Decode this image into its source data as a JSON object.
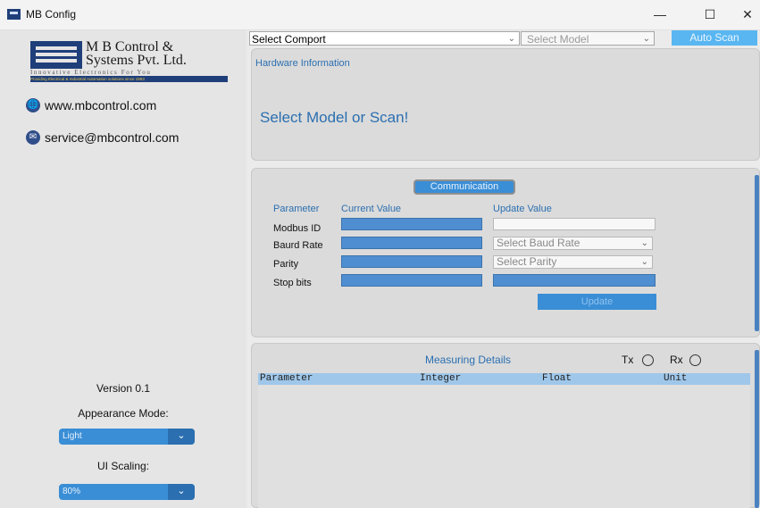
{
  "window": {
    "title": "MB Config",
    "controls": {
      "minimize": "—",
      "maximize": "☐",
      "close": "✕"
    }
  },
  "sidebar": {
    "logo": {
      "line1": "M B Control &",
      "line2": "Systems Pvt. Ltd.",
      "tagline": "Innovative Electronics For You",
      "strip": "Providing Electrical & Industrial Automation solutions since 1983"
    },
    "website": "www.mbcontrol.com",
    "email": "service@mbcontrol.com",
    "version": "Version 0.1",
    "appearance_label": "Appearance Mode:",
    "appearance_value": "Light",
    "scaling_label": "UI Scaling:",
    "scaling_value": "80%"
  },
  "toolbar": {
    "comport_value": "Select Comport",
    "model_placeholder": "Select Model",
    "auto_scan_label": "Auto Scan"
  },
  "hardware": {
    "title": "Hardware Information",
    "status": "Select Model or Scan!"
  },
  "communication": {
    "title": "Communication",
    "headers": {
      "parameter": "Parameter",
      "current": "Current Value",
      "update": "Update Value"
    },
    "rows": [
      {
        "label": "Modbus ID"
      },
      {
        "label": "Baurd Rate",
        "update_placeholder": "Select Baud Rate"
      },
      {
        "label": "Parity",
        "update_placeholder": "Select Parity"
      },
      {
        "label": "Stop bits"
      }
    ],
    "update_button": "Update"
  },
  "measuring": {
    "title": "Measuring Details",
    "tx_label": "Tx",
    "rx_label": "Rx",
    "columns": [
      "Parameter",
      "Integer",
      "Float",
      "Unit"
    ]
  },
  "colors": {
    "accent": "#3a8ed6",
    "accent_dark": "#2b6fb0",
    "auto_scan": "#59b6f1",
    "table_header": "#9fc7ea"
  },
  "icons": {
    "website": "globe-icon",
    "email": "envelope-icon",
    "dropdown": "chevron-down-icon"
  }
}
